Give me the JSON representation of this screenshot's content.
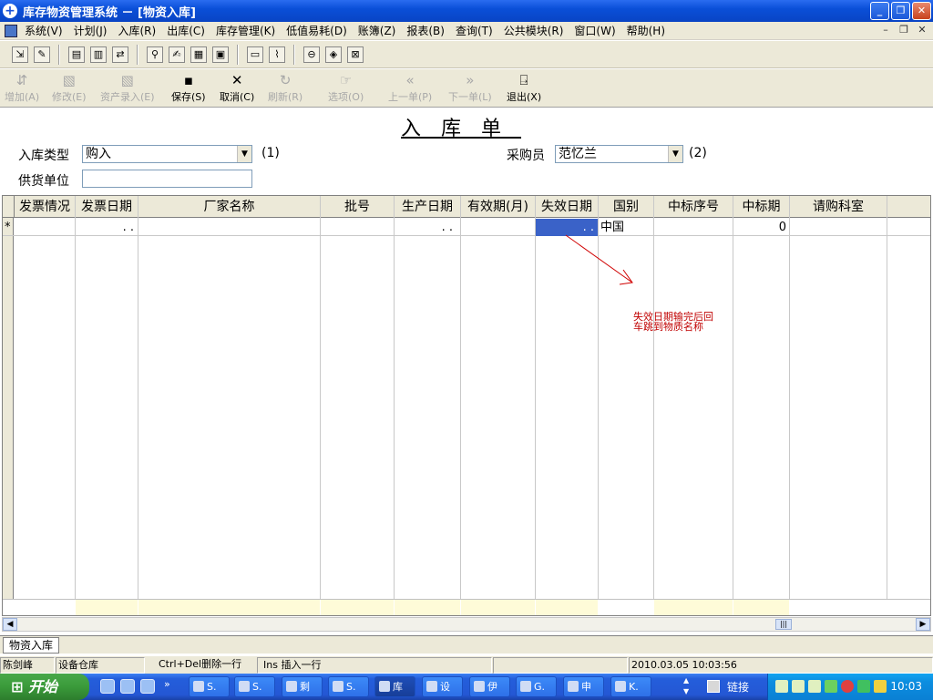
{
  "window": {
    "title": "库存物资管理系统 － [物资入库]"
  },
  "menu": [
    "系统(V)",
    "计划(J)",
    "入库(R)",
    "出库(C)",
    "库存管理(K)",
    "低值易耗(D)",
    "账簿(Z)",
    "报表(B)",
    "查询(T)",
    "公共模块(R)",
    "窗口(W)",
    "帮助(H)"
  ],
  "toolbar2": {
    "add": "增加(A)",
    "edit": "修改(E)",
    "asset": "资产录入(E)",
    "save": "保存(S)",
    "cancel": "取消(C)",
    "refresh": "刷新(R)",
    "options": "选项(O)",
    "prev": "上一单(P)",
    "next": "下一单(L)",
    "exit": "退出(X)"
  },
  "form": {
    "doc_title": "入库单",
    "type_label": "入库类型",
    "type_value": "购入",
    "type_hint": "(1)",
    "buyer_label": "采购员",
    "buyer_value": "范忆兰",
    "buyer_hint": "(2)",
    "supplier_label": "供货单位",
    "supplier_value": ""
  },
  "grid": {
    "columns": [
      "发票情况",
      "发票日期",
      "厂家名称",
      "批号",
      "生产日期",
      "有效期(月)",
      "失效日期",
      "国别",
      "中标序号",
      "中标期",
      "请购科室"
    ],
    "row": {
      "indicator": "*",
      "invoice_date": ". .",
      "prod_date": ". .",
      "expire_date": ". .",
      "country": "中国",
      "bid_period": "0"
    }
  },
  "annotation": "失效日期输完后回车跳到物质名称",
  "mdi_tab": "物资入库",
  "status": {
    "user": "陈剑峰",
    "warehouse": "设备仓库",
    "hint1": "Ctrl+Del删除一行",
    "hint2": "Ins 插入一行",
    "datetime": "2010.03.05 10:03:56"
  },
  "taskbar": {
    "start": "开始",
    "tasks": [
      "S.",
      "S.",
      "剩",
      "S.",
      "库",
      "设",
      "伊",
      "G.",
      "申",
      "K."
    ],
    "links": "链接",
    "clock": "10:03"
  }
}
